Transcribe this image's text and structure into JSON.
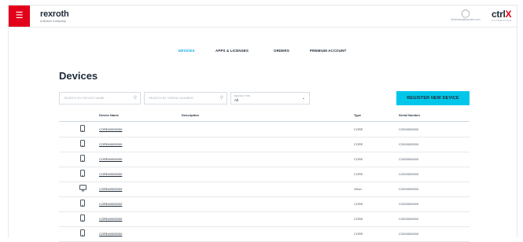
{
  "header": {
    "menu_icon": "hamburger-icon",
    "brand": "rexroth",
    "brand_sub": "A Bosch Company",
    "user_icon": "user-icon",
    "user_name": "firstname@domain.com",
    "product_main": "ctrl",
    "product_x": "X",
    "product_tag": "AUTOMATION"
  },
  "nav": {
    "tabs": [
      {
        "label": "DEVICES",
        "active": true
      },
      {
        "label": "APPS & LICENSES",
        "active": false
      },
      {
        "label": "ORDERS",
        "active": false
      },
      {
        "label": "PREMIUM ACCOUNT",
        "active": false
      }
    ]
  },
  "page": {
    "title": "Devices"
  },
  "filters": {
    "name_placeholder": "SEARCH BY DEVICE NAME",
    "serial_placeholder": "SEARCH BY SERIAL NUMBER",
    "search_icon": "search-icon",
    "type_label": "DEVICE TYPE",
    "type_value": "All",
    "chevron_icon": "chevron-down-icon"
  },
  "actions": {
    "register_label": "REGISTER NEW DEVICE"
  },
  "table": {
    "columns": {
      "name": "Device Name",
      "description": "Description",
      "type": "Type",
      "serial": "Serial Number"
    },
    "rows": [
      {
        "icon": "phone-device-icon",
        "name": "CORE#0000000",
        "type": "CORE",
        "serial": "C2000000000"
      },
      {
        "icon": "phone-device-icon",
        "name": "CORE#0000000",
        "type": "CORE",
        "serial": "C2000000000"
      },
      {
        "icon": "phone-device-icon",
        "name": "CORE#0000000",
        "type": "CORE",
        "serial": "C2000000000"
      },
      {
        "icon": "phone-device-icon",
        "name": "CORE#0000000",
        "type": "CORE",
        "serial": "C2000000000"
      },
      {
        "icon": "monitor-device-icon",
        "name": "CORE#0000000",
        "type": "Other",
        "serial": "C2000000000"
      },
      {
        "icon": "phone-device-icon",
        "name": "CORE#0000000",
        "type": "CORE",
        "serial": "C2000000000"
      },
      {
        "icon": "phone-device-icon",
        "name": "CORE#0000000",
        "type": "CORE",
        "serial": "C2000000000"
      },
      {
        "icon": "phone-device-icon",
        "name": "CORE#0000000",
        "type": "CORE",
        "serial": "C2000000000"
      }
    ]
  },
  "colors": {
    "accent": "#00c7ea",
    "active_tab": "#00a8e0",
    "brand_red": "#e2001a",
    "text": "#1e2a37"
  }
}
